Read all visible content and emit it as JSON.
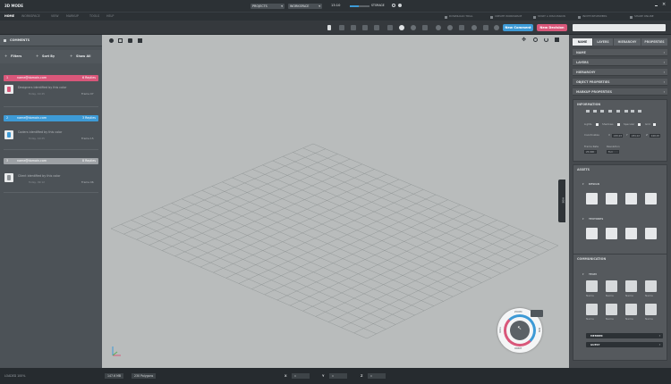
{
  "app": {
    "title": "3D MODE"
  },
  "topbar": {
    "projects_label": "PROJECTS",
    "workspace_label": "WORKSPACE",
    "time": "13:10",
    "storage_label": "STORAGE"
  },
  "menu": {
    "items": [
      "HOME",
      "WORKSPACE",
      "VIEW",
      "MARKUP",
      "TOOLS",
      "HELP"
    ],
    "links": [
      "DOWNLOAD TRIAL",
      "CREATE WORKSPACE",
      "START A DISCUSSION",
      "INVITE REVIEWERS",
      "SHARE ONLINE"
    ]
  },
  "toolbar": {
    "new_comment": "New Comment",
    "new_decision": "New Decision",
    "search_placeholder": ""
  },
  "comments": {
    "title": "COMMENTS",
    "filters": "Filters",
    "sort_by": "Sort By",
    "show_all": "Show All",
    "items": [
      {
        "num": "1",
        "email": "name@domain.com",
        "replies": "6 Replies",
        "text": "Designers identified by this color",
        "meta": "Today, 10:45",
        "frame": "Frame 07",
        "color": "#d9577a"
      },
      {
        "num": "2",
        "email": "name@domain.com",
        "replies": "3 Replies",
        "text": "Coders identified by this color",
        "meta": "Today, 10:25",
        "frame": "Frame 15",
        "color": "#3d9ad6"
      },
      {
        "num": "3",
        "email": "name@domain.com",
        "replies": "8 Replies",
        "text": "Client identified by this color",
        "meta": "Today, 09:12",
        "frame": "Frame 06",
        "color": "#9ea2a6"
      }
    ]
  },
  "viewport": {
    "nav": {
      "zoom": "ZOOM",
      "pan": "PAN",
      "orbit": "ORBIT",
      "roll": "ROLL"
    },
    "side_tab": "HIDE"
  },
  "right": {
    "tabs": [
      "NAME",
      "LAYERS",
      "HIERARCHY",
      "PROPERTIES"
    ],
    "sections": [
      "NAME",
      "LAYERS",
      "HIERARCHY",
      "OBJECT PROPERTIES",
      "MARKUP PROPERTIES"
    ],
    "information": {
      "title": "INFORMATION",
      "checks": [
        "Lights",
        "Shadows",
        "Specular",
        "Grid"
      ],
      "coord_label": "Coordinates",
      "coords": [
        {
          "axis": "X",
          "value": "215.23"
        },
        {
          "axis": "Y",
          "value": "231.12"
        },
        {
          "axis": "Z",
          "value": "100.15"
        }
      ],
      "frame_rate_label": "Frame Rate",
      "frame_rate": "25.000",
      "resolution_label": "Resolution",
      "resolution": "Full"
    },
    "assets": {
      "title": "ASSETS",
      "groups": [
        "DESIGN",
        "TEXTURES"
      ]
    },
    "communication": {
      "title": "COMMUNICATION",
      "group": "TEAM",
      "member_label": "Name",
      "buttons": [
        "MEMBER",
        "GUEST"
      ]
    }
  },
  "status": {
    "loaded": "LOADED 100%",
    "memory": "147.6 MB",
    "polygons": "230 Polygons",
    "x_label": "X",
    "x": "0",
    "y_label": "Y",
    "y": "0",
    "z_label": "Z",
    "z": "0"
  }
}
